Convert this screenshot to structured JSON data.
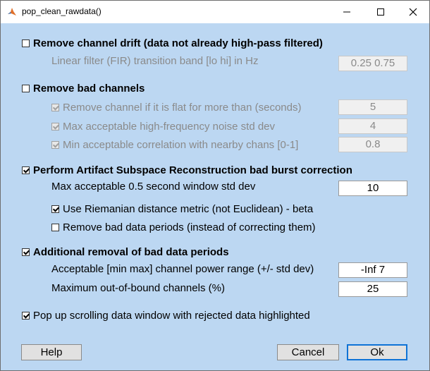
{
  "window": {
    "title": "pop_clean_rawdata()"
  },
  "sections": {
    "drift": {
      "label": "Remove channel drift (data not already high-pass filtered)",
      "checked": false,
      "filter_label": "Linear filter (FIR) transition band [lo hi] in Hz",
      "filter_value": "0.25 0.75"
    },
    "bad_channels": {
      "label": "Remove bad channels",
      "checked": false,
      "flat_label": "Remove channel if it is flat for more than (seconds)",
      "flat_value": "5",
      "noise_label": "Max acceptable high-frequency noise std dev",
      "noise_value": "4",
      "corr_label": "Min acceptable correlation with nearby chans [0-1]",
      "corr_value": "0.8"
    },
    "asr": {
      "label": "Perform Artifact Subspace Reconstruction bad burst correction",
      "checked": true,
      "window_label": "Max acceptable 0.5 second window std dev",
      "window_value": "10",
      "riemann_label": "Use Riemanian distance metric (not Euclidean) - beta",
      "riemann_checked": true,
      "remove_periods_label": "Remove bad data periods (instead of correcting them)",
      "remove_periods_checked": false
    },
    "additional": {
      "label": "Additional removal of bad data periods",
      "checked": true,
      "power_label": "Acceptable [min max] channel power range (+/- std dev)",
      "power_value": "-Inf 7",
      "oob_label": "Maximum out-of-bound channels (%)",
      "oob_value": "25"
    },
    "popup": {
      "label": "Pop up scrolling data window with rejected data highlighted",
      "checked": true
    }
  },
  "buttons": {
    "help": "Help",
    "cancel": "Cancel",
    "ok": "Ok"
  },
  "colors": {
    "background": "#bcd7f2",
    "default_button_border": "#0f73d6"
  }
}
